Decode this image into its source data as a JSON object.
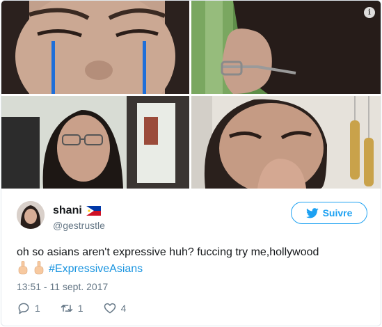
{
  "photos": {
    "items": [
      {
        "subject": "crying-face-drawn-tears"
      },
      {
        "subject": "side-profile-with-glasses"
      },
      {
        "subject": "selfie-in-car-glasses"
      },
      {
        "subject": "crying-hand-over-mouth"
      }
    ],
    "info_icon": "i"
  },
  "tweet": {
    "author": {
      "name": "shani",
      "handle": "@gestrustle",
      "flag_icon": "philippines-flag-icon"
    },
    "follow_label": "Suivre",
    "text_line1": "oh so asians aren't expressive huh? fuccing try me,hollywood",
    "emoji_icons": [
      "middle-finger-icon",
      "middle-finger-icon"
    ],
    "hashtag": "#ExpressiveAsians",
    "timestamp": "13:51 - 11 sept. 2017",
    "actions": {
      "replies": "1",
      "retweets": "1",
      "likes": "4"
    }
  },
  "colors": {
    "accent": "#1da1f2",
    "hashtag": "#1b95e0",
    "muted": "#657786",
    "border": "#e1e8ed"
  }
}
